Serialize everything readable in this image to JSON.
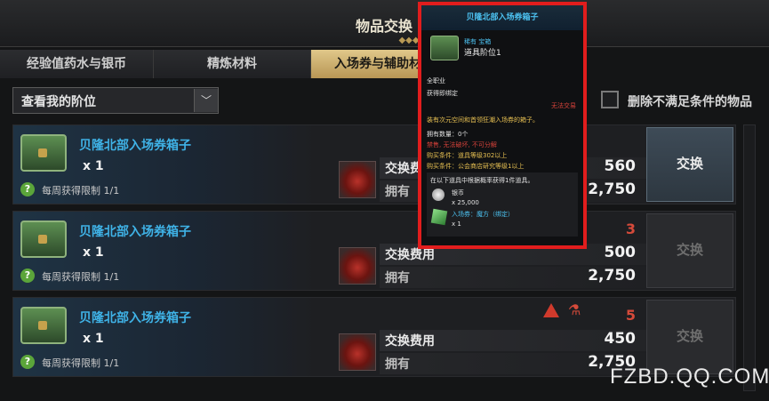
{
  "window": {
    "title": "物品交换",
    "ornament": "◆◆◆"
  },
  "tabs": [
    {
      "label": "经验值药水与银币",
      "active": false
    },
    {
      "label": "精炼材料",
      "active": false
    },
    {
      "label": "入场券与辅助材",
      "active": true
    }
  ],
  "filter": {
    "dropdown_value": "查看我的阶位",
    "dropdown_arrow": "﹀",
    "checkbox_label": "删除不满足条件的物品",
    "checkbox_checked": false
  },
  "rows": [
    {
      "item_name": "贝隆北部入场券箱子",
      "qty": "x 1",
      "limit": "每周获得限制 1/1",
      "cost_label": "交换费用",
      "owned_label": "拥有",
      "cost": "560",
      "owned": "2,750",
      "red_count": "",
      "button": "交换",
      "button_enabled": true
    },
    {
      "item_name": "贝隆北部入场券箱子",
      "qty": "x 1",
      "limit": "每周获得限制 1/1",
      "cost_label": "交换费用",
      "owned_label": "拥有",
      "cost": "500",
      "owned": "2,750",
      "red_count": "3",
      "button": "交换",
      "button_enabled": false
    },
    {
      "item_name": "贝隆北部入场券箱子",
      "qty": "x 1",
      "limit": "每周获得限制 1/1",
      "cost_label": "交换费用",
      "owned_label": "拥有",
      "cost": "450",
      "owned": "2,750",
      "red_count": "5",
      "button": "交换",
      "button_enabled": false
    }
  ],
  "tooltip": {
    "title": "贝隆北部入场券箱子",
    "rarity": "稀有 宝箱",
    "name": "道具阶位1",
    "class": "全职业",
    "bind": "获得即绑定",
    "trade": "无法交易",
    "desc": "装有次元空间和首领狂潮入场券的箱子。",
    "owned": "拥有数量：0个",
    "restrictions": "禁售, 无法破坏, 不可分解",
    "req1": "购买条件：道具等级302以上",
    "req2": "购买条件：公会商店研究等级1以上",
    "rewards_header": "在以下道具中根据概率获得1件道具。",
    "reward1_name": "银币",
    "reward1_qty": "x 25,000",
    "reward2_name": "入场券：魔方（绑定）",
    "reward2_qty": "x 1"
  },
  "watermark": "FZBD.QQ.COM",
  "colors": {
    "accent_blue": "#3fb2e6",
    "tab_active": "#d4b878",
    "warning_red": "#d54a3a",
    "highlight_frame": "#e11d1d"
  }
}
